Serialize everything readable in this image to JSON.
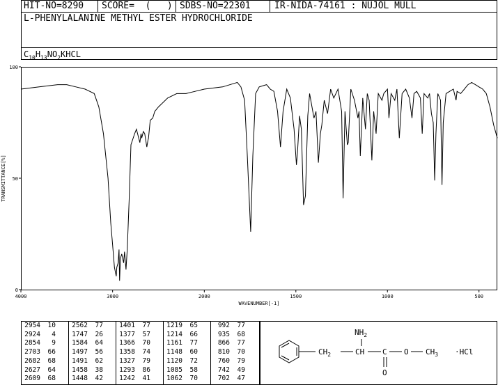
{
  "header": {
    "hit_no": "HIT-NO=8290",
    "score": "SCORE=  (   )",
    "sdbs_no": "SDBS-NO=22301",
    "ir_info": "IR-NIDA-74161 : NUJOL MULL",
    "compound_name": "L-PHENYLALANINE METHYL ESTER HYDROCHLORIDE",
    "formula": {
      "c": "C",
      "c_n": "10",
      "h": "H",
      "h_n": "13",
      "n": "NO",
      "o_n": "2",
      "rest": "KHCL"
    }
  },
  "chart_data": {
    "type": "line",
    "xlabel": "WAVENUMBER[-1]",
    "ylabel": "TRANSMITTANCE[%]",
    "xlim": [
      4000,
      400
    ],
    "ylim": [
      0,
      100
    ],
    "x_ticks": [
      "4000",
      "3000",
      "2000",
      "1500",
      "1000",
      "500"
    ],
    "y_ticks": [
      "100",
      "50",
      "0"
    ],
    "grid": false,
    "series": [
      {
        "points": [
          [
            4000,
            90
          ],
          [
            3800,
            91
          ],
          [
            3600,
            92
          ],
          [
            3500,
            92
          ],
          [
            3400,
            91
          ],
          [
            3300,
            90
          ],
          [
            3200,
            88
          ],
          [
            3150,
            82
          ],
          [
            3100,
            70
          ],
          [
            3050,
            50
          ],
          [
            3020,
            30
          ],
          [
            3000,
            20
          ],
          [
            2980,
            10
          ],
          [
            2960,
            6
          ],
          [
            2954,
            10
          ],
          [
            2940,
            12
          ],
          [
            2930,
            18
          ],
          [
            2924,
            4
          ],
          [
            2915,
            14
          ],
          [
            2900,
            16
          ],
          [
            2880,
            12
          ],
          [
            2870,
            17
          ],
          [
            2854,
            9
          ],
          [
            2840,
            18
          ],
          [
            2820,
            40
          ],
          [
            2800,
            65
          ],
          [
            2760,
            70
          ],
          [
            2740,
            72
          ],
          [
            2703,
            66
          ],
          [
            2690,
            70
          ],
          [
            2682,
            68
          ],
          [
            2665,
            71
          ],
          [
            2650,
            70
          ],
          [
            2627,
            64
          ],
          [
            2615,
            67
          ],
          [
            2609,
            68
          ],
          [
            2590,
            76
          ],
          [
            2562,
            77
          ],
          [
            2540,
            80
          ],
          [
            2500,
            82
          ],
          [
            2400,
            86
          ],
          [
            2300,
            88
          ],
          [
            2200,
            88
          ],
          [
            2100,
            89
          ],
          [
            2000,
            90
          ],
          [
            1900,
            91
          ],
          [
            1820,
            93
          ],
          [
            1800,
            91
          ],
          [
            1780,
            85
          ],
          [
            1765,
            60
          ],
          [
            1747,
            26
          ],
          [
            1735,
            60
          ],
          [
            1720,
            88
          ],
          [
            1700,
            91
          ],
          [
            1660,
            92
          ],
          [
            1640,
            90
          ],
          [
            1620,
            89
          ],
          [
            1600,
            80
          ],
          [
            1584,
            64
          ],
          [
            1570,
            80
          ],
          [
            1550,
            90
          ],
          [
            1530,
            86
          ],
          [
            1510,
            72
          ],
          [
            1497,
            56
          ],
          [
            1491,
            62
          ],
          [
            1480,
            78
          ],
          [
            1470,
            72
          ],
          [
            1458,
            38
          ],
          [
            1448,
            42
          ],
          [
            1435,
            78
          ],
          [
            1425,
            88
          ],
          [
            1401,
            77
          ],
          [
            1390,
            80
          ],
          [
            1377,
            57
          ],
          [
            1366,
            70
          ],
          [
            1358,
            74
          ],
          [
            1345,
            85
          ],
          [
            1327,
            79
          ],
          [
            1310,
            90
          ],
          [
            1293,
            86
          ],
          [
            1270,
            90
          ],
          [
            1250,
            80
          ],
          [
            1242,
            41
          ],
          [
            1232,
            80
          ],
          [
            1219,
            65
          ],
          [
            1214,
            66
          ],
          [
            1200,
            90
          ],
          [
            1180,
            85
          ],
          [
            1161,
            77
          ],
          [
            1155,
            80
          ],
          [
            1148,
            60
          ],
          [
            1135,
            86
          ],
          [
            1120,
            72
          ],
          [
            1110,
            88
          ],
          [
            1100,
            85
          ],
          [
            1085,
            58
          ],
          [
            1075,
            80
          ],
          [
            1062,
            70
          ],
          [
            1050,
            88
          ],
          [
            1030,
            85
          ],
          [
            1020,
            88
          ],
          [
            1000,
            90
          ],
          [
            992,
            77
          ],
          [
            980,
            88
          ],
          [
            960,
            85
          ],
          [
            948,
            90
          ],
          [
            935,
            68
          ],
          [
            920,
            88
          ],
          [
            900,
            90
          ],
          [
            880,
            86
          ],
          [
            866,
            77
          ],
          [
            855,
            88
          ],
          [
            840,
            89
          ],
          [
            820,
            86
          ],
          [
            810,
            70
          ],
          [
            800,
            88
          ],
          [
            780,
            86
          ],
          [
            770,
            88
          ],
          [
            760,
            79
          ],
          [
            750,
            75
          ],
          [
            742,
            49
          ],
          [
            735,
            70
          ],
          [
            725,
            88
          ],
          [
            710,
            85
          ],
          [
            702,
            47
          ],
          [
            695,
            75
          ],
          [
            680,
            88
          ],
          [
            660,
            89
          ],
          [
            640,
            90
          ],
          [
            625,
            85
          ],
          [
            620,
            89
          ],
          [
            600,
            88
          ],
          [
            580,
            90
          ],
          [
            560,
            92
          ],
          [
            540,
            93
          ],
          [
            520,
            92
          ],
          [
            500,
            91
          ],
          [
            480,
            90
          ],
          [
            460,
            88
          ],
          [
            440,
            82
          ],
          [
            420,
            74
          ],
          [
            400,
            68
          ]
        ]
      }
    ],
    "peak_table": [
      [
        [
          2954,
          10
        ],
        [
          2924,
          4
        ],
        [
          2854,
          9
        ],
        [
          2703,
          66
        ],
        [
          2682,
          68
        ],
        [
          2627,
          64
        ],
        [
          2609,
          68
        ]
      ],
      [
        [
          2562,
          77
        ],
        [
          1747,
          26
        ],
        [
          1584,
          64
        ],
        [
          1497,
          56
        ],
        [
          1491,
          62
        ],
        [
          1458,
          38
        ],
        [
          1448,
          42
        ]
      ],
      [
        [
          1401,
          77
        ],
        [
          1377,
          57
        ],
        [
          1366,
          70
        ],
        [
          1358,
          74
        ],
        [
          1327,
          79
        ],
        [
          1293,
          86
        ],
        [
          1242,
          41
        ]
      ],
      [
        [
          1219,
          65
        ],
        [
          1214,
          66
        ],
        [
          1161,
          77
        ],
        [
          1148,
          60
        ],
        [
          1120,
          72
        ],
        [
          1085,
          58
        ],
        [
          1062,
          70
        ]
      ],
      [
        [
          992,
          77
        ],
        [
          935,
          68
        ],
        [
          866,
          77
        ],
        [
          810,
          70
        ],
        [
          760,
          79
        ],
        [
          742,
          49
        ],
        [
          702,
          47
        ]
      ]
    ]
  },
  "structure": {
    "nh2": "NH",
    "nh2_sub": "2",
    "ch2": "CH",
    "ch2_sub": "2",
    "ch": "CH",
    "c": "C",
    "o": "O",
    "carbonyl_o": "O",
    "ch3": "CH",
    "ch3_sub": "3",
    "hcl": "·HCl"
  }
}
